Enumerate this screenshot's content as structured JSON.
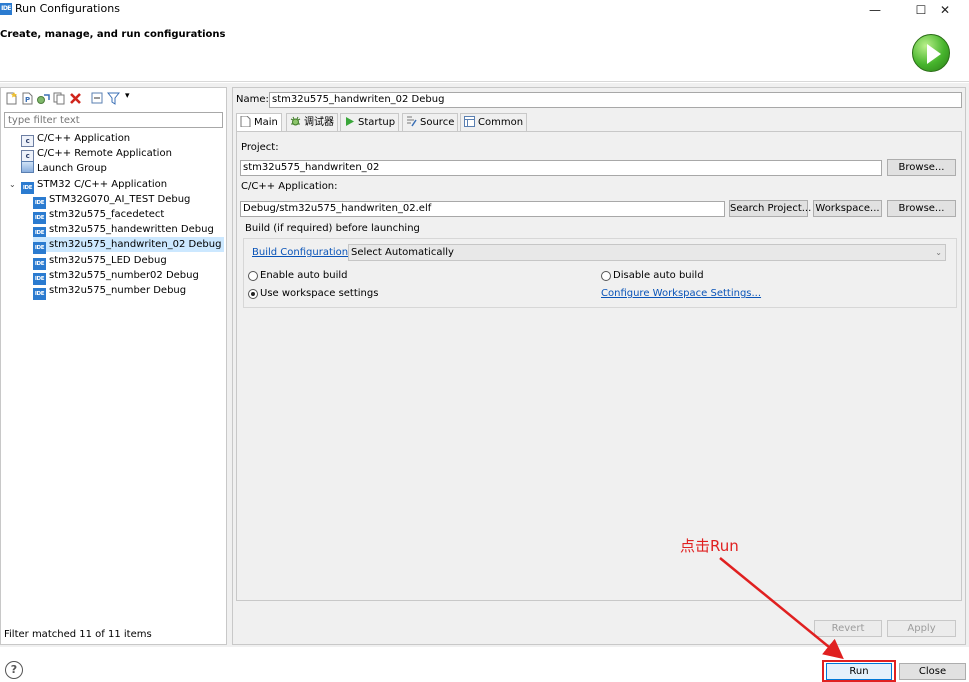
{
  "window": {
    "app_icon_text": "IDE",
    "title": "Run Configurations",
    "minimize_glyph": "—",
    "maximize_glyph": "☐",
    "close_glyph": "✕"
  },
  "header": {
    "title": "Create, manage, and run configurations",
    "logo_icon": "run-launch-icon"
  },
  "toolbar": {
    "icons": [
      "new-configuration-icon",
      "new-prototype-icon",
      "export-icon",
      "duplicate-icon",
      "delete-icon",
      "collapse-all-icon",
      "filter-icon",
      "view-menu-icon"
    ],
    "dropdown_glyph": "▾"
  },
  "filter": {
    "placeholder": "type filter text",
    "status": "Filter matched 11 of 11 items"
  },
  "tree": {
    "expand_glyph": "⌄",
    "items": [
      {
        "label": "C/C++ Application",
        "icon": "c",
        "icon_text": "c",
        "level": 1
      },
      {
        "label": "C/C++ Remote Application",
        "icon": "c",
        "icon_text": "c",
        "level": 1
      },
      {
        "label": "Launch Group",
        "icon": "launch",
        "icon_text": "",
        "level": 1
      },
      {
        "label": "STM32 C/C++ Application",
        "icon": "ide",
        "icon_text": "IDE",
        "level": 1,
        "expanded": true
      },
      {
        "label": "STM32G070_AI_TEST Debug",
        "icon": "ide",
        "icon_text": "IDE",
        "level": 2
      },
      {
        "label": "stm32u575_facedetect",
        "icon": "ide",
        "icon_text": "IDE",
        "level": 2
      },
      {
        "label": "stm32u575_handewritten Debug",
        "icon": "ide",
        "icon_text": "IDE",
        "level": 2
      },
      {
        "label": "stm32u575_handwriten_02 Debug",
        "icon": "ide",
        "icon_text": "IDE",
        "level": 2,
        "selected": true
      },
      {
        "label": "stm32u575_LED Debug",
        "icon": "ide",
        "icon_text": "IDE",
        "level": 2
      },
      {
        "label": "stm32u575_number02 Debug",
        "icon": "ide",
        "icon_text": "IDE",
        "level": 2
      },
      {
        "label": "stm32u575_number Debug",
        "icon": "ide",
        "icon_text": "IDE",
        "level": 2
      }
    ]
  },
  "config": {
    "name_label": "Name:",
    "name_value": "stm32u575_handwriten_02 Debug",
    "tabs": [
      {
        "label": "Main",
        "icon": "main-tab-icon",
        "active": true
      },
      {
        "label": "调试器",
        "icon": "debugger-tab-icon"
      },
      {
        "label": "Startup",
        "icon": "startup-tab-icon"
      },
      {
        "label": "Source",
        "icon": "source-tab-icon"
      },
      {
        "label": "Common",
        "icon": "common-tab-icon"
      }
    ],
    "project_label": "Project:",
    "project_value": "stm32u575_handwriten_02",
    "browse_label": "Browse...",
    "app_label": "C/C++ Application:",
    "app_value": "Debug/stm32u575_handwriten_02.elf",
    "search_project_label": "Search Project...",
    "workspace_label": "Workspace...",
    "build_group_label": "Build (if required) before launching",
    "build_config_label": "Build Configuration:",
    "build_config_value": "Select Automatically",
    "combo_arrow": "⌄",
    "enable_auto_build": "Enable auto build",
    "disable_auto_build": "Disable auto build",
    "use_workspace_settings": "Use workspace settings",
    "configure_workspace_link": "Configure Workspace Settings...",
    "selected_build_option": "use_workspace_settings"
  },
  "actions": {
    "revert": "Revert",
    "apply": "Apply",
    "run": "Run",
    "close": "Close",
    "help_glyph": "?"
  },
  "annotation": {
    "text": "点击Run",
    "color": "#e02020"
  }
}
